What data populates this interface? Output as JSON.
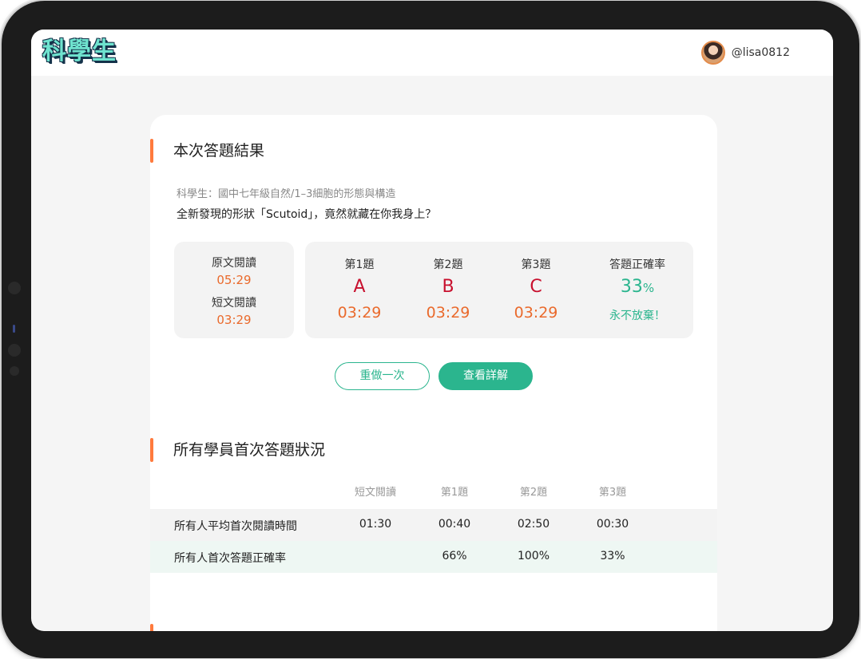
{
  "app": {
    "logo": "科學生"
  },
  "header": {
    "username": "@lisa0812"
  },
  "result": {
    "title": "本次答題結果",
    "breadcrumb": "科學生：國中七年級自然/1–3細胞的形態與構造",
    "subject": "全新發現的形狀「Scutoid」，竟然就藏在你我身上？",
    "reading": {
      "original_label": "原文閱讀",
      "original_time": "05:29",
      "short_label": "短文閱讀",
      "short_time": "03:29"
    },
    "questions": [
      {
        "label": "第1題",
        "answer": "A",
        "time": "03:29"
      },
      {
        "label": "第2題",
        "answer": "B",
        "time": "03:29"
      },
      {
        "label": "第3題",
        "answer": "C",
        "time": "03:29"
      }
    ],
    "accuracy": {
      "label": "答題正確率",
      "value": "33",
      "unit": "%",
      "note": "永不放棄！"
    },
    "buttons": {
      "redo": "重做一次",
      "details": "查看詳解"
    }
  },
  "stats": {
    "title": "所有學員首次答題狀況",
    "columns": [
      "短文閱讀",
      "第1題",
      "第2題",
      "第3題"
    ],
    "rows": [
      {
        "label": "所有人平均首次閱讀時間",
        "values": [
          "01:30",
          "00:40",
          "02:50",
          "00:30"
        ]
      },
      {
        "label": "所有人首次答題正確率",
        "values": [
          "",
          "66%",
          "100%",
          "33%"
        ]
      }
    ]
  },
  "colors": {
    "accent": "#ff7a3d",
    "primary": "#2bb58e",
    "wrong": "#c8102e",
    "time": "#ea6a2c"
  }
}
